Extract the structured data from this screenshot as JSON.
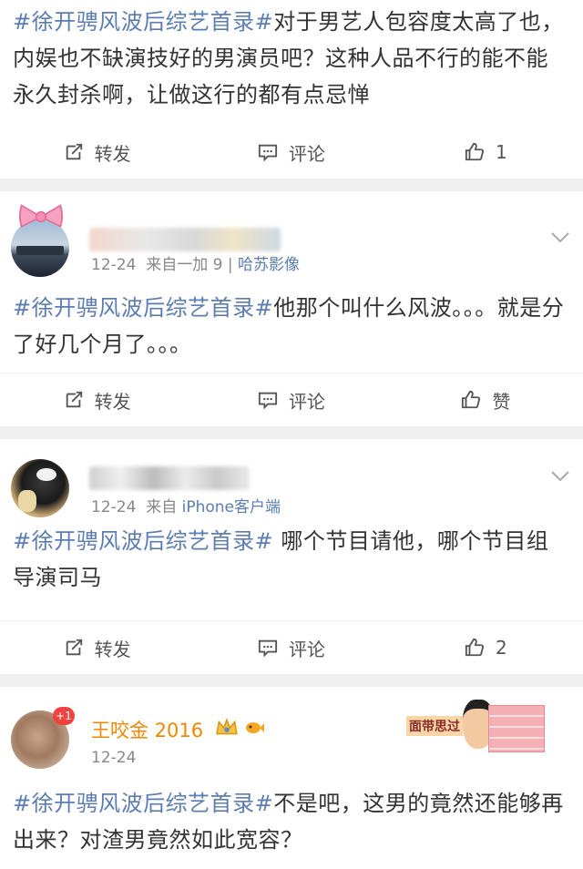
{
  "post1": {
    "hashtag": "#徐开骋风波后综艺首录#",
    "body": "对于男艺人包容度太高了也，内娱也不缺演技好的男演员吧？这种人品不行的能不能永久封杀啊，让做这行的都有点忌惮",
    "repost_label": "转发",
    "comment_label": "评论",
    "like_count": "1"
  },
  "post2": {
    "date": "12-24",
    "source_prefix": "来自一加 9",
    "source_sep": " | ",
    "source_link": "哈苏影像",
    "hashtag": "#徐开骋风波后综艺首录#",
    "body": "他那个叫什么风波。。。就是分了好几个月了。。。",
    "repost_label": "转发",
    "comment_label": "评论",
    "like_label": "赞"
  },
  "post3": {
    "date": "12-24",
    "source_prefix": "来自 ",
    "source_link": "iPhone客户端",
    "hashtag": "#徐开骋风波后综艺首录#",
    "body": " 哪个节目请他，哪个节目组导演司马",
    "repost_label": "转发",
    "comment_label": "评论",
    "like_count": "2"
  },
  "post4": {
    "username": "王咬金 2016",
    "badge": "+1",
    "date": "12-24",
    "sticker_text": "面带思过",
    "hashtag": "#徐开骋风波后综艺首录#",
    "body": "不是吧，这男的竟然还能够再出来？对渣男竟然如此宽容？"
  },
  "colors": {
    "link": "#5b7db1",
    "username": "#f08700",
    "badge": "#f0433f"
  }
}
